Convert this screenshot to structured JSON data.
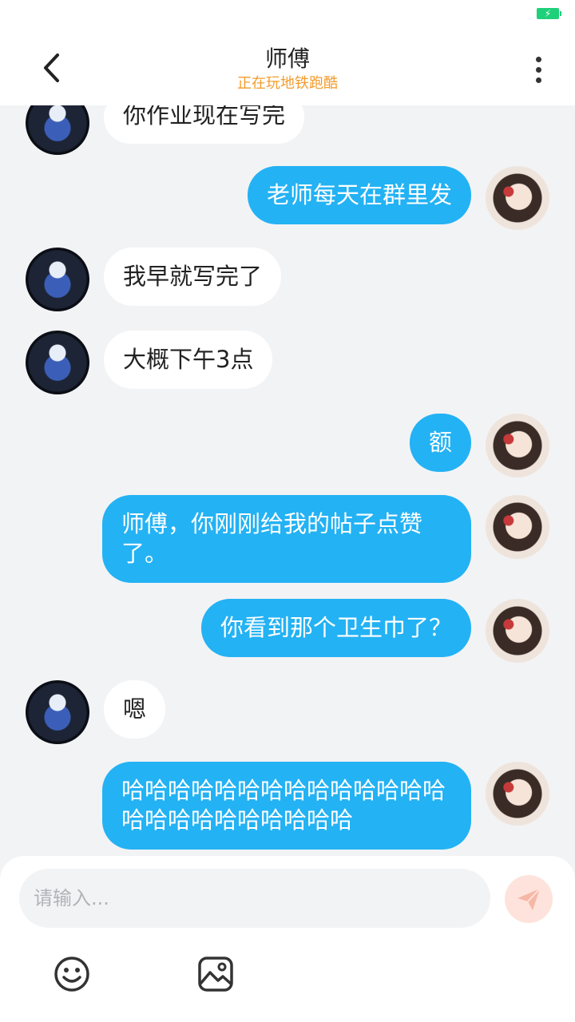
{
  "header": {
    "title": "师傅",
    "subtitle": "正在玩地铁跑酷"
  },
  "messages": [
    {
      "side": "left",
      "text": "你作业现在写完"
    },
    {
      "side": "right",
      "text": "老师每天在群里发"
    },
    {
      "side": "left",
      "text": "我早就写完了"
    },
    {
      "side": "left",
      "text": "大概下午3点"
    },
    {
      "side": "right",
      "text": "额"
    },
    {
      "side": "right",
      "text": "师傅，你刚刚给我的帖子点赞了。"
    },
    {
      "side": "right",
      "text": "你看到那个卫生巾了？"
    },
    {
      "side": "left",
      "text": "嗯"
    },
    {
      "side": "right",
      "text": "哈哈哈哈哈哈哈哈哈哈哈哈哈哈哈哈哈哈哈哈哈哈哈哈"
    }
  ],
  "composer": {
    "placeholder": "请输入..."
  },
  "icons": {
    "back": "chevron-left-icon",
    "more": "more-vertical-icon",
    "send": "send-icon",
    "emoji": "emoji-icon",
    "image": "image-icon",
    "battery": "battery-charging-icon"
  },
  "colors": {
    "outgoing_bubble": "#23b2f4",
    "incoming_bubble": "#ffffff",
    "subtitle": "#f39c2c",
    "battery": "#1fd07a",
    "send_button": "#fde3dc"
  }
}
